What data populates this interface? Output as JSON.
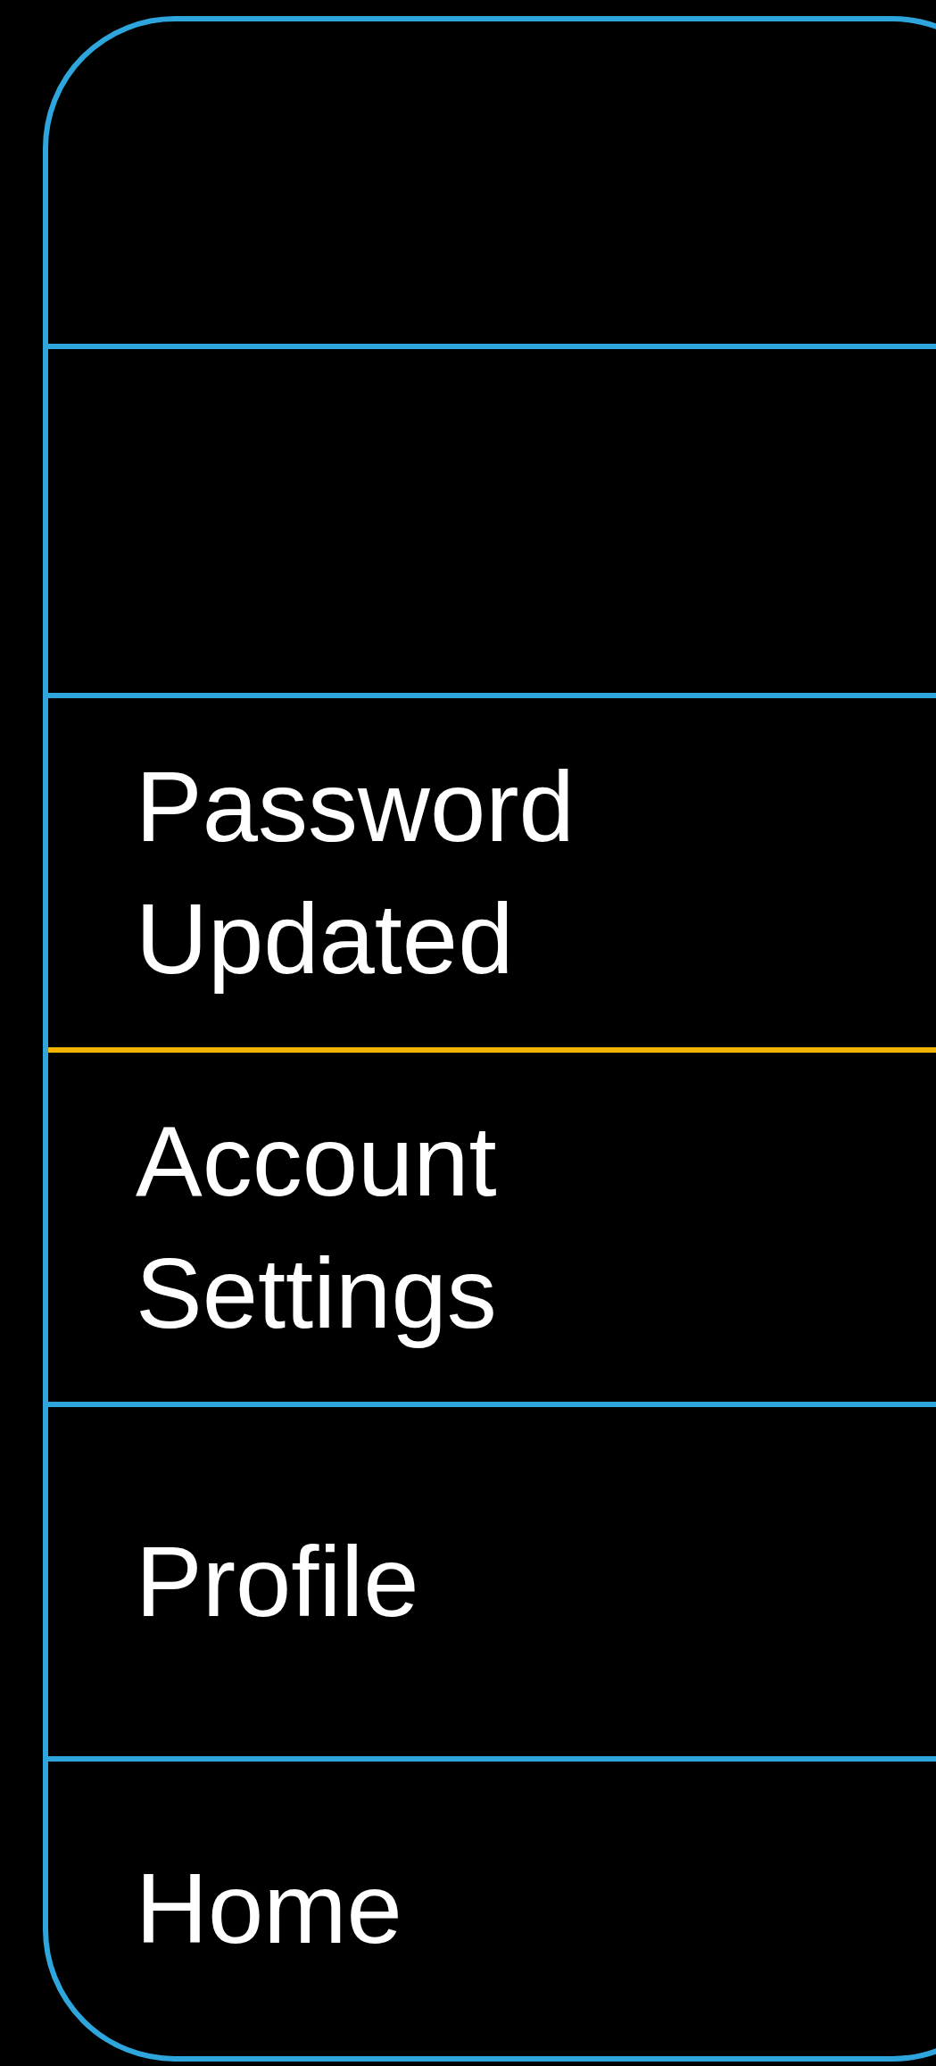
{
  "stack": {
    "rows": [
      {
        "label": "Password\nUpdated",
        "highlighted": false
      },
      {
        "label": "Account\nSettings",
        "highlighted": true
      },
      {
        "label": "Profile",
        "highlighted": false
      },
      {
        "label": "Home",
        "highlighted": false
      }
    ]
  }
}
